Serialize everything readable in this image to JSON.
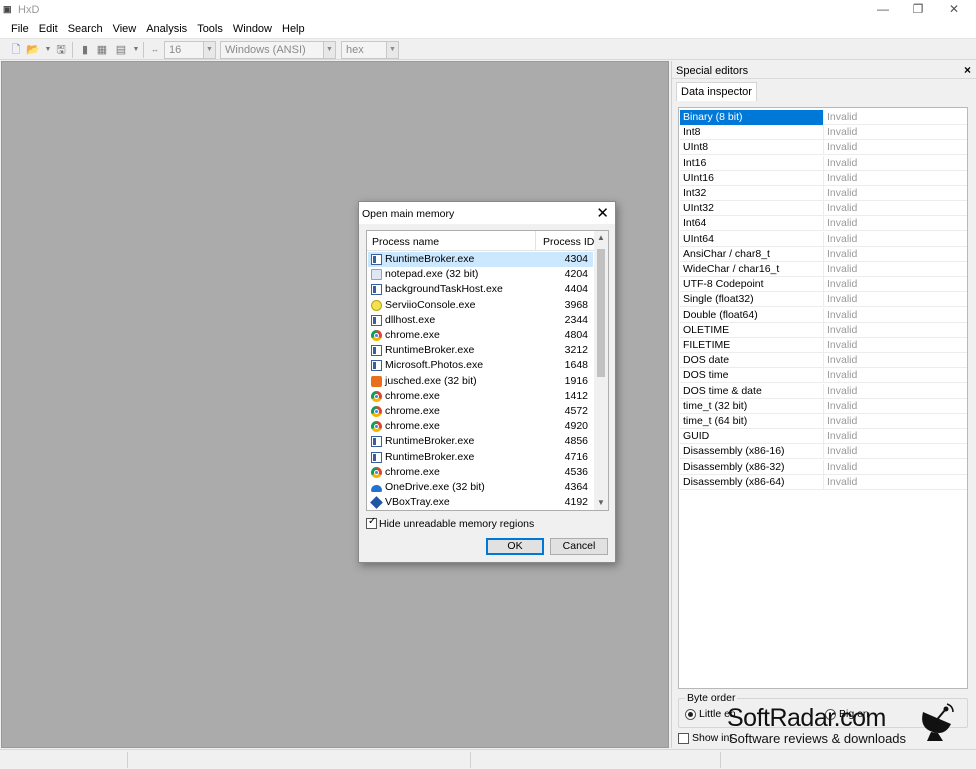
{
  "window": {
    "title": "HxD",
    "minimize": "—",
    "restore": "❐",
    "close": "✕"
  },
  "menu": [
    "File",
    "Edit",
    "Search",
    "View",
    "Analysis",
    "Tools",
    "Window",
    "Help"
  ],
  "toolbar": {
    "bytes_per_row": "16",
    "charset": "Windows (ANSI)",
    "offset_base": "hex"
  },
  "side_panel": {
    "title": "Special editors",
    "close": "×",
    "tab": "Data inspector",
    "rows": [
      {
        "name": "Binary (8 bit)",
        "value": "Invalid"
      },
      {
        "name": "Int8",
        "value": "Invalid"
      },
      {
        "name": "UInt8",
        "value": "Invalid"
      },
      {
        "name": "Int16",
        "value": "Invalid"
      },
      {
        "name": "UInt16",
        "value": "Invalid"
      },
      {
        "name": "Int32",
        "value": "Invalid"
      },
      {
        "name": "UInt32",
        "value": "Invalid"
      },
      {
        "name": "Int64",
        "value": "Invalid"
      },
      {
        "name": "UInt64",
        "value": "Invalid"
      },
      {
        "name": "AnsiChar / char8_t",
        "value": "Invalid"
      },
      {
        "name": "WideChar / char16_t",
        "value": "Invalid"
      },
      {
        "name": "UTF-8 Codepoint",
        "value": "Invalid"
      },
      {
        "name": "Single (float32)",
        "value": "Invalid"
      },
      {
        "name": "Double (float64)",
        "value": "Invalid"
      },
      {
        "name": "OLETIME",
        "value": "Invalid"
      },
      {
        "name": "FILETIME",
        "value": "Invalid"
      },
      {
        "name": "DOS date",
        "value": "Invalid"
      },
      {
        "name": "DOS time",
        "value": "Invalid"
      },
      {
        "name": "DOS time & date",
        "value": "Invalid"
      },
      {
        "name": "time_t (32 bit)",
        "value": "Invalid"
      },
      {
        "name": "time_t (64 bit)",
        "value": "Invalid"
      },
      {
        "name": "GUID",
        "value": "Invalid"
      },
      {
        "name": "Disassembly (x86-16)",
        "value": "Invalid"
      },
      {
        "name": "Disassembly (x86-32)",
        "value": "Invalid"
      },
      {
        "name": "Disassembly (x86-64)",
        "value": "Invalid"
      }
    ],
    "byte_order_label": "Byte order",
    "little_endian": "Little en",
    "big_endian": "Big en",
    "show_integers": "Show int"
  },
  "dialog": {
    "title": "Open main memory",
    "close": "✕",
    "col_name": "Process name",
    "col_pid": "Process ID",
    "processes": [
      {
        "name": "RuntimeBroker.exe",
        "pid": "4304",
        "icon": "win"
      },
      {
        "name": "notepad.exe (32 bit)",
        "pid": "4204",
        "icon": "note"
      },
      {
        "name": "backgroundTaskHost.exe",
        "pid": "4404",
        "icon": "win"
      },
      {
        "name": "ServiioConsole.exe",
        "pid": "3968",
        "icon": "serviio"
      },
      {
        "name": "dllhost.exe",
        "pid": "2344",
        "icon": "win"
      },
      {
        "name": "chrome.exe",
        "pid": "4804",
        "icon": "chrome"
      },
      {
        "name": "RuntimeBroker.exe",
        "pid": "3212",
        "icon": "win"
      },
      {
        "name": "Microsoft.Photos.exe",
        "pid": "1648",
        "icon": "win"
      },
      {
        "name": "jusched.exe (32 bit)",
        "pid": "1916",
        "icon": "java"
      },
      {
        "name": "chrome.exe",
        "pid": "1412",
        "icon": "chrome"
      },
      {
        "name": "chrome.exe",
        "pid": "4572",
        "icon": "chrome"
      },
      {
        "name": "chrome.exe",
        "pid": "4920",
        "icon": "chrome"
      },
      {
        "name": "RuntimeBroker.exe",
        "pid": "4856",
        "icon": "win"
      },
      {
        "name": "RuntimeBroker.exe",
        "pid": "4716",
        "icon": "win"
      },
      {
        "name": "chrome.exe",
        "pid": "4536",
        "icon": "chrome"
      },
      {
        "name": "OneDrive.exe (32 bit)",
        "pid": "4364",
        "icon": "cloud"
      },
      {
        "name": "VBoxTray.exe",
        "pid": "4192",
        "icon": "vbox"
      }
    ],
    "hide_unreadable": "Hide unreadable memory regions",
    "ok": "OK",
    "cancel": "Cancel"
  },
  "watermark": {
    "brand": "SoftRadar.com",
    "tagline": "Software reviews & downloads"
  },
  "colors": {
    "selection": "#0078d7",
    "list_selection": "#cce8ff",
    "workspace": "#ababab"
  }
}
